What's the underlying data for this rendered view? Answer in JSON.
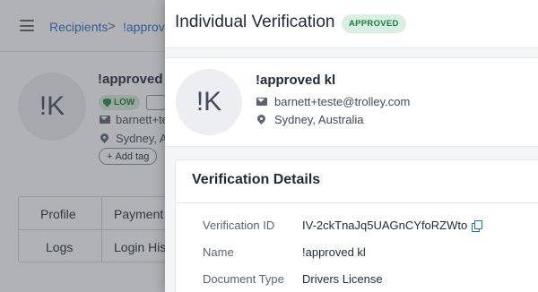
{
  "background": {
    "breadcrumb": {
      "root": "Recipients",
      "separator": ">",
      "current": "!approved"
    },
    "recipient": {
      "initials": "!K",
      "name": "!approved kl",
      "risk_badge": "LOW",
      "email_partial": "barnett+te",
      "location_partial": "Sydney, A",
      "add_tag": "Add tag",
      "add_tag_plus": "+"
    },
    "tabs": [
      "Profile",
      "Payment",
      "Logs",
      "Login His"
    ]
  },
  "drawer": {
    "title": "Individual Verification",
    "status_badge": "APPROVED",
    "profile": {
      "initials": "!K",
      "name": "!approved kl",
      "email": "barnett+teste@trolley.com",
      "location": "Sydney, Australia"
    },
    "details": {
      "title": "Verification Details",
      "rows": [
        {
          "label": "Verification ID",
          "value": "IV-2ckTnaJq5UAGnCYfoRZWto"
        },
        {
          "label": "Name",
          "value": "!approved kl"
        },
        {
          "label": "Document Type",
          "value": "Drivers License"
        }
      ]
    }
  },
  "colors": {
    "link": "#1c6fcc",
    "approved_bg": "#d9efe2",
    "approved_text": "#1d7a45",
    "overlay": "rgba(70,72,78,0.42)"
  },
  "icons": [
    "menu-icon",
    "mail-icon",
    "location-pin-icon",
    "copy-icon",
    "shield-icon",
    "id-card-icon"
  ]
}
